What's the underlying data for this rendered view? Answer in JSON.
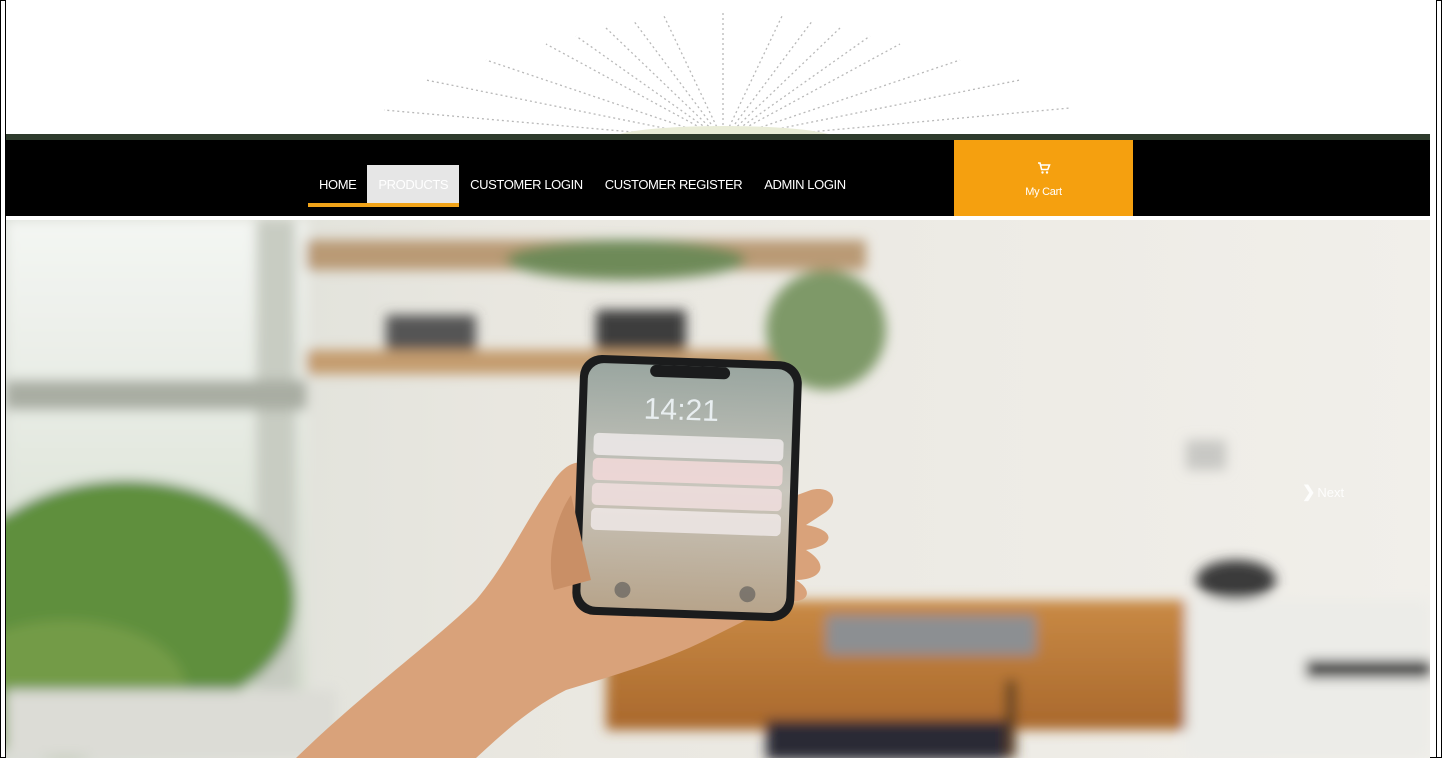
{
  "nav": {
    "items": [
      {
        "label": "HOME",
        "active": true
      },
      {
        "label": "PRODUCTS",
        "active": true
      },
      {
        "label": "CUSTOMER LOGIN"
      },
      {
        "label": "CUSTOMER REGISTER"
      },
      {
        "label": "ADMIN LOGIN"
      }
    ],
    "cart_label": "My Cart",
    "cart_icon": "shopping-cart-icon"
  },
  "hero": {
    "next_label": "Next",
    "next_icon": "chevron-right-icon",
    "phone_time": "14:21"
  },
  "colors": {
    "navbar_bg": "#000000",
    "accent": "#f5a00f",
    "top_strip": "#2e3b2c",
    "active_tab_bg": "#e6e6e6"
  }
}
